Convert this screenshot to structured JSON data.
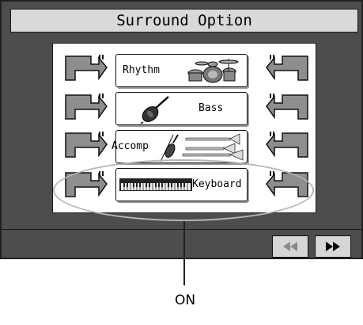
{
  "window": {
    "title": "Surround Option"
  },
  "parts": [
    {
      "label": "Rhythm",
      "icon": "drum-kit-icon"
    },
    {
      "label": "Bass",
      "icon": "cello-icon"
    },
    {
      "label": "Accomp",
      "icon": "violin-trombone-icon"
    },
    {
      "label": "Keyboard",
      "icon": "piano-keyboard-icon"
    }
  ],
  "navigation": {
    "prev_icon": "rewind-icon",
    "next_icon": "fast-forward-icon"
  },
  "callout": {
    "label": "ON"
  },
  "colors": {
    "screen": "#4d4d4d",
    "title_bar": "#d9d9d9",
    "arrow": "#8e8e8e",
    "nav_prev_icon": "#8a8a8a",
    "nav_next_icon": "#000000"
  }
}
